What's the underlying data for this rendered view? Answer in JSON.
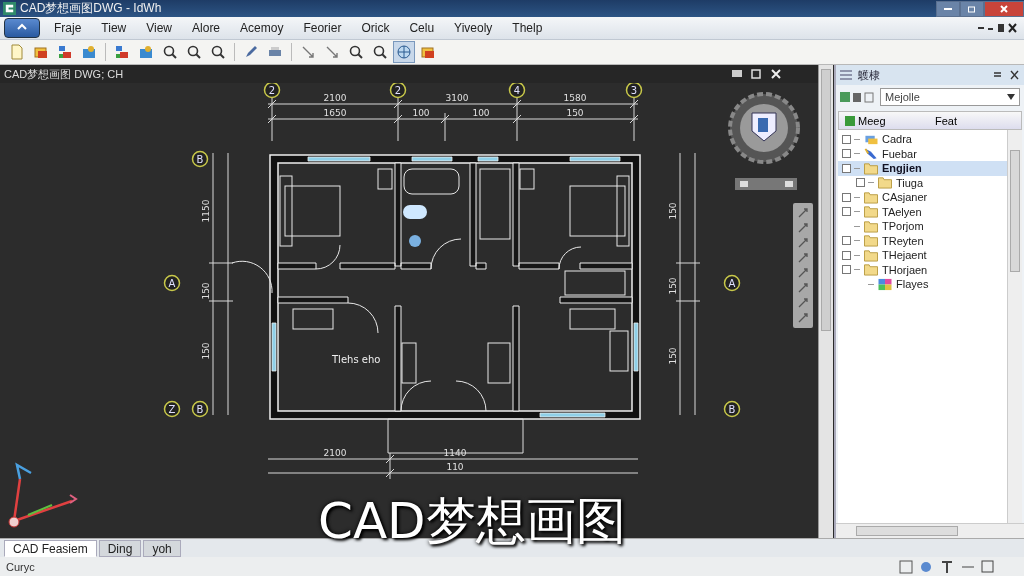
{
  "window": {
    "title": "CAD梦想画图DWG - IdWh"
  },
  "menu": [
    "Fraje",
    "Tiew",
    "View",
    "Alore",
    "Acemoy",
    "Feorier",
    "Orick",
    "Celu",
    "Yiveoly",
    "Thelp"
  ],
  "toolbar": [
    {
      "kind": "page",
      "selected": false
    },
    {
      "kind": "open",
      "selected": false
    },
    {
      "kind": "layers",
      "selected": false
    },
    {
      "kind": "image",
      "selected": false
    },
    {
      "kind": "layers",
      "selected": false
    },
    {
      "kind": "image",
      "selected": false
    },
    {
      "kind": "zoom",
      "selected": false
    },
    {
      "kind": "zoom",
      "selected": false
    },
    {
      "kind": "zoom",
      "selected": false
    },
    {
      "kind": "pencil",
      "selected": false
    },
    {
      "kind": "printer",
      "selected": false
    },
    {
      "kind": "arrow",
      "selected": false
    },
    {
      "kind": "arrow",
      "selected": false
    },
    {
      "kind": "zoom",
      "selected": false
    },
    {
      "kind": "zoom",
      "selected": false
    },
    {
      "kind": "globe",
      "selected": true
    },
    {
      "kind": "open",
      "selected": false
    }
  ],
  "document": {
    "title": "CAD梦想画图 DWG; CH"
  },
  "drawing": {
    "top_bubbles": [
      "2",
      "2",
      "4",
      "3"
    ],
    "left_bubbles": [
      "B",
      "A",
      "Z",
      "B"
    ],
    "right_bubbles": [
      "A",
      "B"
    ],
    "top_overall": [
      "2100",
      "3100",
      "1580"
    ],
    "top_detail": [
      "1650",
      "100",
      "100",
      "150"
    ],
    "bottom_overall": [
      "2100",
      "1140"
    ],
    "bottom_detail": [
      "110"
    ],
    "left_dims": [
      "1150",
      "150",
      "150"
    ],
    "right_dims": [
      "150",
      "150",
      "150"
    ],
    "room_label": "Tlehs eho"
  },
  "caption": "CAD梦想画图",
  "panel": {
    "title": "鸌棣",
    "dropdown": "Mejolle",
    "columns": [
      "Meeg",
      "Feat"
    ],
    "tree": [
      {
        "label": "Cadra",
        "kind": "layer",
        "toggle": true,
        "selected": false
      },
      {
        "label": "Fuebar",
        "kind": "pen",
        "toggle": true,
        "selected": false
      },
      {
        "label": "Engjien",
        "kind": "folder",
        "toggle": true,
        "selected": true,
        "children": [
          {
            "label": "Tiuga",
            "kind": "folder",
            "toggle": true,
            "selected": false
          }
        ]
      },
      {
        "label": "CAsjaner",
        "kind": "folder",
        "toggle": true,
        "selected": false
      },
      {
        "label": "TAelyen",
        "kind": "folder",
        "toggle": true,
        "selected": false
      },
      {
        "label": "TPorjom",
        "kind": "folder",
        "toggle": false,
        "selected": false
      },
      {
        "label": "TReyten",
        "kind": "folder",
        "toggle": true,
        "selected": false
      },
      {
        "label": "THejaent",
        "kind": "folder",
        "toggle": true,
        "selected": false
      },
      {
        "label": "THorjaen",
        "kind": "folder",
        "toggle": true,
        "selected": false,
        "children": [
          {
            "label": "Flayes",
            "kind": "palette",
            "toggle": false,
            "selected": false
          }
        ]
      }
    ]
  },
  "tabs": [
    {
      "label": "CAD Feasiem",
      "selected": true
    },
    {
      "label": "Ding",
      "selected": false
    },
    {
      "label": "yoh",
      "selected": false
    }
  ],
  "status": "Curyc"
}
